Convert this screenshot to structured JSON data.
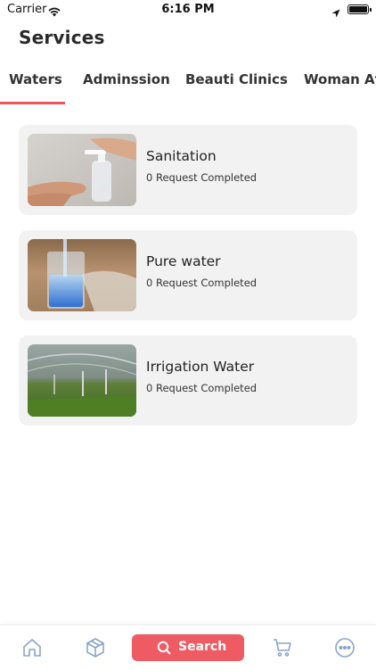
{
  "status_bar": {
    "carrier": "Carrier",
    "time": "6:16 PM"
  },
  "page_title": "Services",
  "tabs": [
    {
      "label": "Waters",
      "selected": true
    },
    {
      "label": "Adminssion",
      "selected": false
    },
    {
      "label": "Beauti Clinics",
      "selected": false
    },
    {
      "label": "Woman Atl",
      "selected": false
    }
  ],
  "services": [
    {
      "title": "Sanitation",
      "subtitle": "0 Request Completed",
      "image": "hand-sanitizer-photo"
    },
    {
      "title": "Pure water",
      "subtitle": "0 Request Completed",
      "image": "water-glass-photo"
    },
    {
      "title": "Irrigation Water",
      "subtitle": "0 Request Completed",
      "image": "sprinkler-field-photo"
    }
  ],
  "bottom_nav": {
    "items": [
      "home-icon",
      "box-icon",
      "cart-icon",
      "more-icon"
    ],
    "search_label": "Search"
  },
  "colors": {
    "accent": "#ef5b63",
    "card_background": "#f2f2f2"
  }
}
